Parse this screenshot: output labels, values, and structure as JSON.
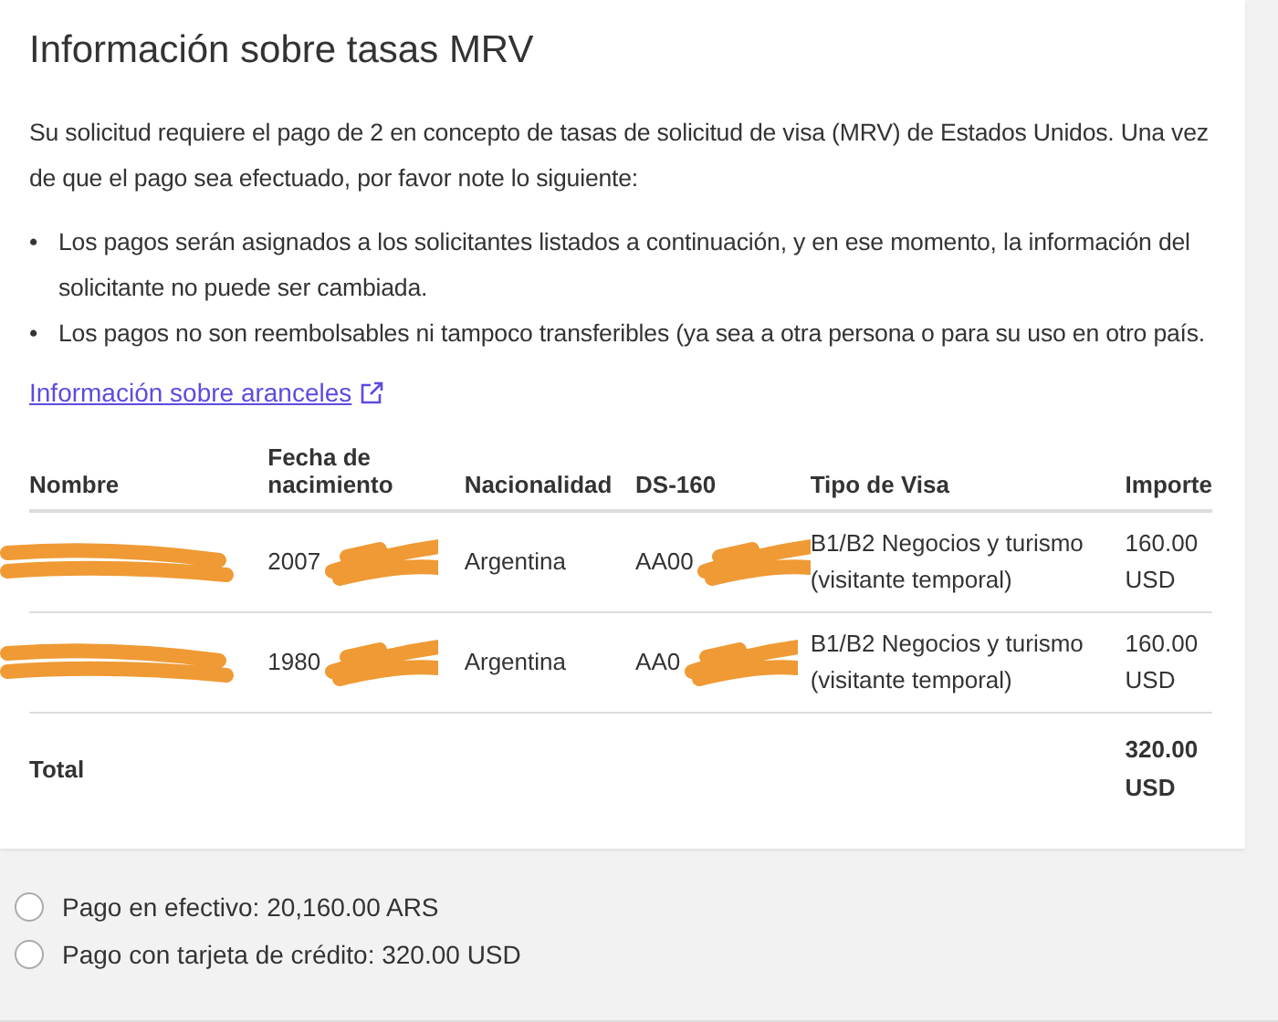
{
  "title": "Información sobre tasas MRV",
  "intro": "Su solicitud requiere el pago de 2 en concepto de tasas de solicitud de visa (MRV) de Estados Unidos. Una vez de que el pago sea efectuado, por favor note lo siguiente:",
  "bullet_marker": "•",
  "bullets": [
    "Los pagos serán asignados a los solicitantes listados a continuación, y en ese momento, la información del solicitante no puede ser cambiada.",
    "Los pagos no son reembolsables ni tampoco transferibles (ya sea a otra persona o para su uso en otro país."
  ],
  "link": "Información sobre aranceles",
  "table": {
    "columns": [
      "Nombre",
      "Fecha de nacimiento",
      "Nacionalidad",
      "DS-160",
      "Tipo de Visa",
      "Importe"
    ],
    "rows": [
      {
        "cells": [
          {
            "redacted": true
          },
          {
            "text": "2007",
            "redacted": true
          },
          {
            "text": "Argentina",
            "redacted": false
          },
          {
            "text": "AA00",
            "redacted": true
          },
          {
            "text": "B1/B2 Negocios y turismo (visitante temporal)",
            "redacted": false
          },
          {
            "text": "160.00 USD",
            "redacted": false
          }
        ]
      },
      {
        "cells": [
          {
            "redacted": true
          },
          {
            "text": "1980",
            "redacted": true
          },
          {
            "text": "Argentina",
            "redacted": false
          },
          {
            "text": "AA0",
            "redacted": true
          },
          {
            "text": "B1/B2 Negocios y turismo (visitante temporal)",
            "redacted": false
          },
          {
            "text": "160.00 USD",
            "redacted": false
          }
        ]
      }
    ],
    "total_label": "Total",
    "total_value": "320.00 USD"
  },
  "payment_options": [
    {
      "label": "Pago en efectivo: 20,160.00 ARS",
      "selected": false
    },
    {
      "label": "Pago con tarjeta de crédito: 320.00 USD",
      "selected": false
    }
  ]
}
